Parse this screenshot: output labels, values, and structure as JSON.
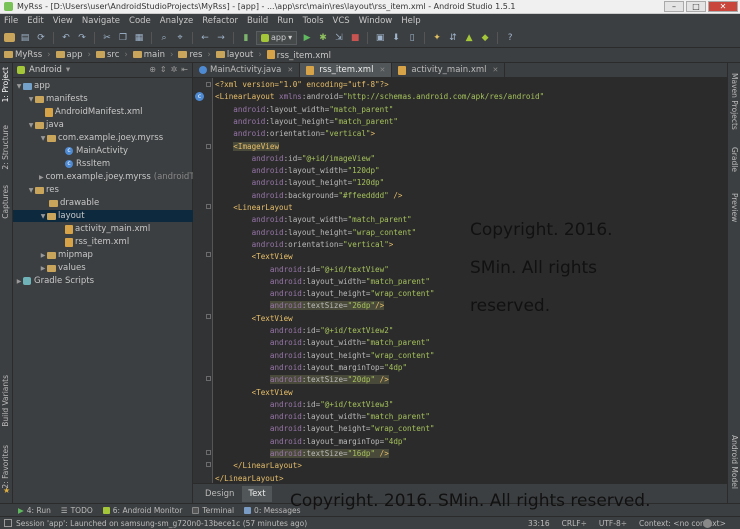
{
  "window": {
    "title": "MyRss - [D:\\Users\\user\\AndroidStudioProjects\\MyRss] - [app] - ...\\app\\src\\main\\res\\layout\\rss_item.xml - Android Studio 1.5.1"
  },
  "menu": [
    "File",
    "Edit",
    "View",
    "Navigate",
    "Code",
    "Analyze",
    "Refactor",
    "Build",
    "Run",
    "Tools",
    "VCS",
    "Window",
    "Help"
  ],
  "toolbar": {
    "run_config": "app"
  },
  "breadcrumb": [
    "MyRss",
    "app",
    "src",
    "main",
    "res",
    "layout",
    "rss_item.xml"
  ],
  "project": {
    "view_mode": "Android",
    "tree": [
      {
        "label": "app",
        "hint": ""
      },
      {
        "label": "manifests",
        "hint": ""
      },
      {
        "label": "AndroidManifest.xml",
        "hint": ""
      },
      {
        "label": "java",
        "hint": ""
      },
      {
        "label": "com.example.joey.myrss",
        "hint": ""
      },
      {
        "label": "MainActivity",
        "hint": ""
      },
      {
        "label": "RssItem",
        "hint": ""
      },
      {
        "label": "com.example.joey.myrss",
        "hint": "(androidTe"
      },
      {
        "label": "res",
        "hint": ""
      },
      {
        "label": "drawable",
        "hint": ""
      },
      {
        "label": "layout",
        "hint": ""
      },
      {
        "label": "activity_main.xml",
        "hint": ""
      },
      {
        "label": "rss_item.xml",
        "hint": ""
      },
      {
        "label": "mipmap",
        "hint": ""
      },
      {
        "label": "values",
        "hint": ""
      },
      {
        "label": "Gradle Scripts",
        "hint": ""
      }
    ]
  },
  "left_tabs": [
    "1: Project",
    "2: Structure",
    "Captures",
    "Build Variants",
    "2: Favorites"
  ],
  "right_tabs": [
    "Maven Projects",
    "Gradle",
    "Preview",
    "Android Model"
  ],
  "editor": {
    "tabs": [
      "MainActivity.java",
      "rss_item.xml",
      "activity_main.xml"
    ],
    "bottom_tabs": [
      "Design",
      "Text"
    ],
    "code": [
      "<?xml version=\"1.0\" encoding=\"utf-8\"?>",
      "<LinearLayout xmlns:android=\"http://schemas.android.com/apk/res/android\"",
      "    android:layout_width=\"match_parent\"",
      "    android:layout_height=\"match_parent\"",
      "    android:orientation=\"vertical\">",
      "    <ImageView",
      "        android:id=\"@+id/imageView\"",
      "        android:layout_width=\"120dp\"",
      "        android:layout_height=\"120dp\"",
      "        android:background=\"#ffeedddd\" />",
      "    <LinearLayout",
      "        android:layout_width=\"match_parent\"",
      "        android:layout_height=\"wrap_content\"",
      "        android:orientation=\"vertical\">",
      "        <TextView",
      "            android:id=\"@+id/textView\"",
      "            android:layout_width=\"match_parent\"",
      "            android:layout_height=\"wrap_content\"",
      "            android:textSize=\"26dp\"/>",
      "        <TextView",
      "            android:id=\"@+id/textView2\"",
      "            android:layout_width=\"match_parent\"",
      "            android:layout_height=\"wrap_content\"",
      "            android:layout_marginTop=\"4dp\"",
      "            android:textSize=\"20dp\" />",
      "        <TextView",
      "            android:id=\"@+id/textView3\"",
      "            android:layout_width=\"match_parent\"",
      "            android:layout_height=\"wrap_content\"",
      "            android:layout_marginTop=\"4dp\"",
      "            android:textSize=\"16dp\" />",
      "    </LinearLayout>",
      "</LinearLayout>"
    ]
  },
  "watermark": {
    "editor_lines": [
      "Copyright. 2016.",
      "SMin. All rights",
      "reserved."
    ],
    "bottom": "Copyright. 2016. SMin. All rights reserved."
  },
  "tool_windows": [
    "4: Run",
    "TODO",
    "6: Android Monitor",
    "Terminal",
    "0: Messages"
  ],
  "status": {
    "message": "Session 'app': Launched on samsung-sm_g720n0-13bece1c (57 minutes ago)",
    "position": "33:16",
    "line_sep": "CRLF÷",
    "encoding": "UTF-8÷",
    "context": "Context: <no context>"
  },
  "colors": {
    "bg": "#2b2b2b",
    "panel": "#3c3f41",
    "tag": "#e8bf6a",
    "value": "#a5c25c",
    "namespace": "#9876aa",
    "selection": "#0d293e"
  }
}
